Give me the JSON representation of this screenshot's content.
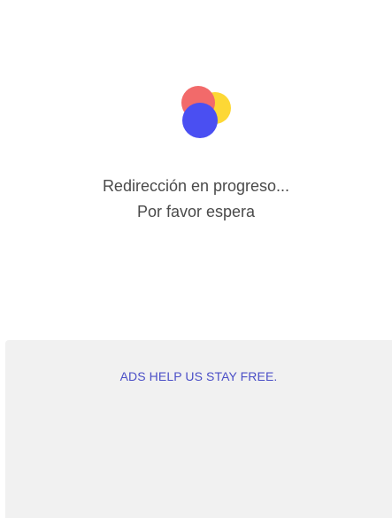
{
  "loader": {
    "icon": "overlapping-dots-loader",
    "colors": {
      "red": "#f26a6a",
      "yellow": "#fdd835",
      "blue": "#4a4ff2"
    }
  },
  "message": {
    "line1": "Redirección en progreso...",
    "line2": "Por favor espera"
  },
  "ad": {
    "text": "ADS HELP US STAY FREE.",
    "background": "#f1f1f1",
    "text_color": "#4b4fc7"
  }
}
